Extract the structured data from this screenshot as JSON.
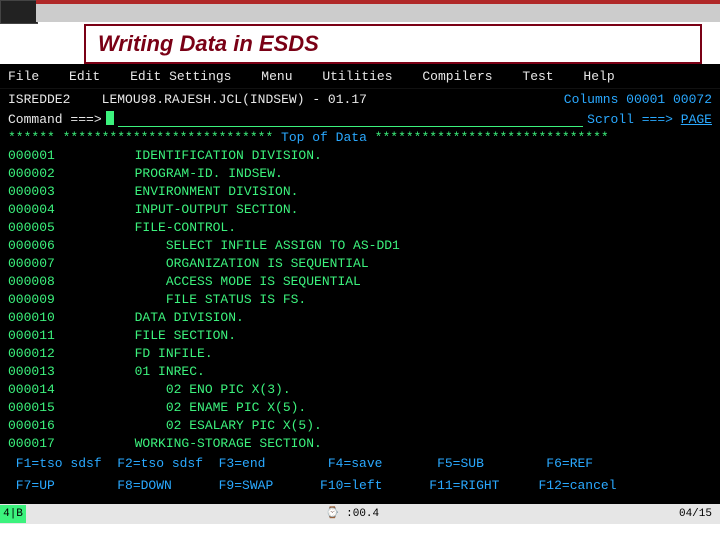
{
  "title": "Writing Data in ESDS",
  "menu": [
    "File",
    "Edit",
    "Edit Settings",
    "Menu",
    "Utilities",
    "Compilers",
    "Test",
    "Help"
  ],
  "header": {
    "env": "ISREDDE2",
    "dataset": "LEMOU98.RAJESH.JCL(INDSEW)",
    "pos": "- 01.17",
    "columns": "Columns 00001 00072"
  },
  "cmd": {
    "label": "Command ===>",
    "scroll_lbl": "Scroll ===>",
    "scroll_val": "PAGE"
  },
  "topdata": {
    "stars_left": "****** ***************************",
    "label": " Top of Data ",
    "stars_right": "******************************"
  },
  "code": [
    {
      "n": "000001",
      "t": "       IDENTIFICATION DIVISION."
    },
    {
      "n": "000002",
      "t": "       PROGRAM-ID. INDSEW."
    },
    {
      "n": "000003",
      "t": "       ENVIRONMENT DIVISION."
    },
    {
      "n": "000004",
      "t": "       INPUT-OUTPUT SECTION."
    },
    {
      "n": "000005",
      "t": "       FILE-CONTROL."
    },
    {
      "n": "000006",
      "t": "           SELECT INFILE ASSIGN TO AS-DD1"
    },
    {
      "n": "000007",
      "t": "           ORGANIZATION IS SEQUENTIAL"
    },
    {
      "n": "000008",
      "t": "           ACCESS MODE IS SEQUENTIAL"
    },
    {
      "n": "000009",
      "t": "           FILE STATUS IS FS."
    },
    {
      "n": "000010",
      "t": "       DATA DIVISION."
    },
    {
      "n": "000011",
      "t": "       FILE SECTION."
    },
    {
      "n": "000012",
      "t": "       FD INFILE."
    },
    {
      "n": "000013",
      "t": "       01 INREC."
    },
    {
      "n": "000014",
      "t": "           02 ENO PIC X(3)."
    },
    {
      "n": "000015",
      "t": "           02 ENAME PIC X(5)."
    },
    {
      "n": "000016",
      "t": "           02 ESALARY PIC X(5)."
    },
    {
      "n": "000017",
      "t": "       WORKING-STORAGE SECTION."
    }
  ],
  "fkeys": {
    "row1": " F1=tso sdsf  F2=tso sdsf  F3=end        F4=save       F5=SUB        F6=REF",
    "row2": " F7=UP        F8=DOWN      F9=SWAP      F10=left      F11=RIGHT     F12=cancel"
  },
  "status": {
    "left": "4|B",
    "center": "⌚ :00.4",
    "right": "04/15"
  }
}
